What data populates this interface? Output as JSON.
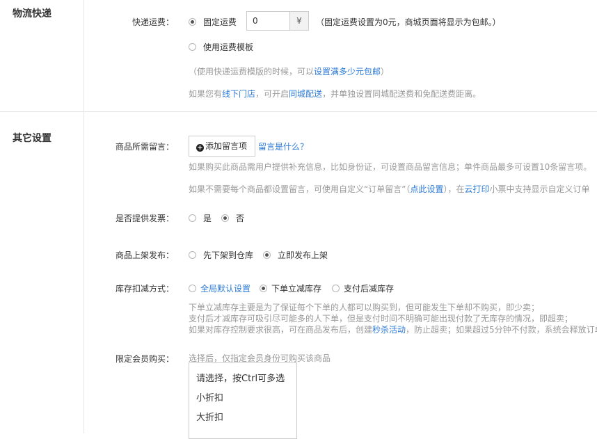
{
  "logistics": {
    "section_title": "物流快递",
    "shipping_label": "快递运费：",
    "fixed_fee_label": "固定运费",
    "fixed_fee_value": "0",
    "currency": "¥",
    "fixed_fee_note": "（固定运费设置为0元，商城页面将显示为包邮。）",
    "template_label": "使用运费模板",
    "template_hint_prefix": "（使用快递运费模版的时候，可以",
    "template_hint_link": "设置满多少元包邮",
    "template_hint_suffix": "）",
    "offline_prefix": "如果您有",
    "offline_link": "线下门店",
    "offline_mid": "，可开启",
    "offline_link2": "同城配送",
    "offline_suffix": "，并单独设置同城配送费和免配送费距离。"
  },
  "other": {
    "section_title": "其它设置",
    "message_label": "商品所需留言：",
    "add_message_button": "添加留言项",
    "what_is_message": "留言是什么？",
    "message_hint1": "如果购买此商品需用户提供补充信息，比如身份证，可设置商品留言信息；单件商品最多可设置10条留言项。",
    "message_hint2_prefix": "如果不需要每个商品都设置留言，可使用自定义“订单留言”（",
    "message_hint2_link": "点此设置",
    "message_hint2_mid": "），在",
    "message_hint2_link2": "云打印",
    "message_hint2_suffix": "小票中支持显示自定义订单",
    "invoice_label": "是否提供发票：",
    "invoice_yes": "是",
    "invoice_no": "否",
    "publish_label": "商品上架发布：",
    "publish_warehouse": "先下架到仓库",
    "publish_now": "立即发布上架",
    "stock_label": "库存扣减方式：",
    "stock_global": "全局默认设置",
    "stock_order": "下单立减库存",
    "stock_pay": "支付后减库存",
    "stock_hint1": "下单立减库存主要是为了保证每个下单的人都可以购买到，但可能发生下单却不购买，即少卖；",
    "stock_hint2": "支付后才减库存可吸引尽可能多的人下单，但是支付时间不明确可能出现付款了无库存的情况，即超卖；",
    "stock_hint3_prefix": "如果对库存控制要求很高，可在商品发布后，创建",
    "stock_hint3_link": "秒杀活动",
    "stock_hint3_suffix": "，防止超卖；如果超过5分钟不付款，系统会释放订单",
    "member_label": "限定会员购买：",
    "member_hint": "选择后，仅指定会员身份可购买该商品",
    "member_options": [
      "请选择，按Ctrl可多选",
      "小折扣",
      "大折扣"
    ]
  }
}
